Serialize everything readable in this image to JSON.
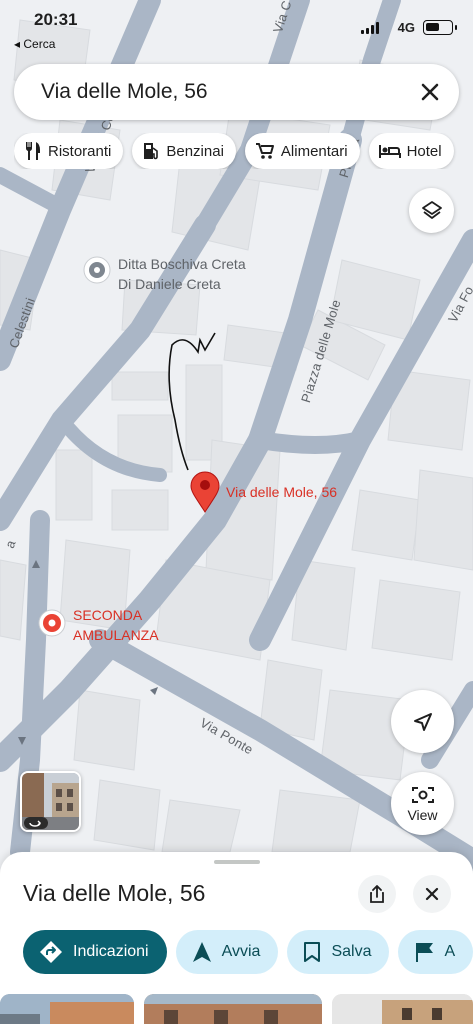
{
  "status_bar": {
    "time": "20:31",
    "back_label": "◂ Cerca",
    "network": "4G"
  },
  "search": {
    "query": "Via delle Mole, 56"
  },
  "chips": [
    {
      "label": "Ristoranti",
      "icon": "fork-knife-icon"
    },
    {
      "label": "Benzinai",
      "icon": "gas-pump-icon"
    },
    {
      "label": "Alimentari",
      "icon": "cart-icon"
    },
    {
      "label": "Hotel",
      "icon": "bed-icon"
    }
  ],
  "map": {
    "places": [
      {
        "name_line1": "Ditta Boschiva Creta",
        "name_line2": "Di Daniele Creta"
      },
      {
        "name_line1": "SECONDA",
        "name_line2": "AMBULANZA"
      }
    ],
    "pin_label": "Via delle Mole, 56",
    "roads": {
      "celestini_1": "Via dei Celestini",
      "celestini_2": "Celestini",
      "piazza_mole": "Piazza delle Mole",
      "piazza_top": "Piazza",
      "via_ponte": "Via Ponte",
      "via_fo": "Via Fo",
      "via_top": "Via C",
      "corner": "a"
    },
    "view_label": "View",
    "colors": {
      "road": "#aab6c6",
      "building": "#e3e5e8",
      "pin": "#ea4335",
      "place_text": "#5f6368",
      "red_text": "#d93025"
    }
  },
  "sheet": {
    "title": "Via delle Mole, 56",
    "actions": [
      {
        "label": "Indicazioni",
        "icon": "directions-icon"
      },
      {
        "label": "Avvia",
        "icon": "navigation-arrow-icon"
      },
      {
        "label": "Salva",
        "icon": "bookmark-icon"
      },
      {
        "label": "A",
        "icon": "flag-icon"
      }
    ],
    "colors": {
      "primary": "#0b6271",
      "secondary": "#d3eefa"
    }
  }
}
